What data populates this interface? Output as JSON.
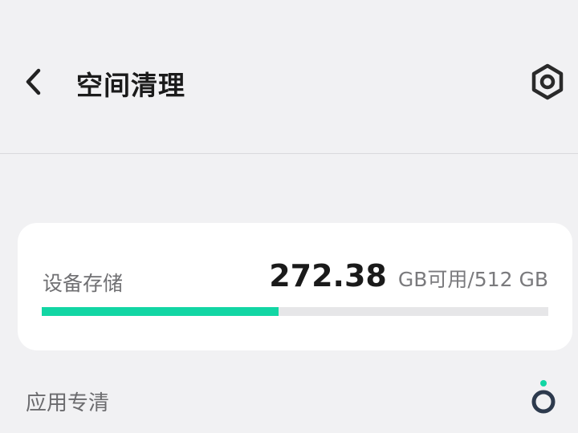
{
  "header": {
    "title": "空间清理",
    "back_icon": "chevron-left-icon",
    "settings_icon": "hexagon-gear-icon"
  },
  "storage": {
    "label": "设备存储",
    "available": "272.38",
    "unit_text": "GB可用/512 GB",
    "used_fraction": 0.468,
    "bar_color": "#12d6a4"
  },
  "section": {
    "label": "应用专清",
    "icon": "app-clean-icon",
    "icon_accent": "#12d6a4"
  }
}
